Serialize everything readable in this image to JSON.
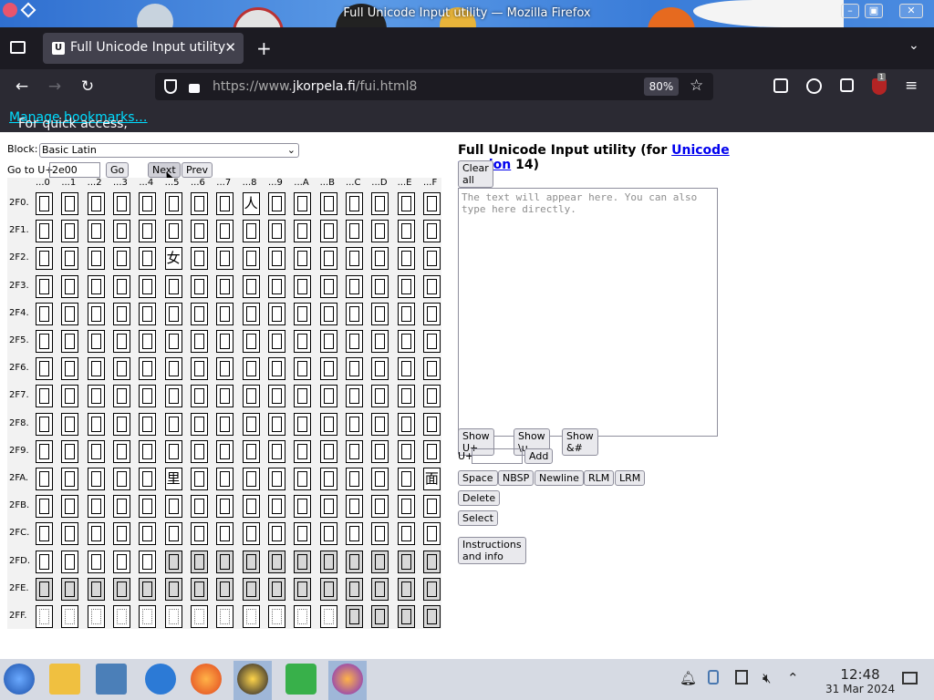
{
  "window": {
    "title": "Full Unicode Input utility — Mozilla Firefox"
  },
  "tab": {
    "label": "Full Unicode Input utility",
    "favicon": "U"
  },
  "nav": {
    "url_prefix": "https://www.",
    "url_domain": "jkorpela.fi",
    "url_path": "/fui.html8",
    "zoom": "80%",
    "addon_badge": "1"
  },
  "bookmarks": {
    "text": "For quick access, place your bookmarks here on the bookmarks toolbar.",
    "link": "Manage bookmarks…"
  },
  "left": {
    "block_label": "Block:",
    "block_value": "Basic Latin",
    "goto_label": "Go to U+",
    "goto_value": "2e00",
    "go_button": "Go",
    "next_button": "Next",
    "prev_button": "Prev",
    "col_headers": [
      "...0",
      "...1",
      "...2",
      "...3",
      "...4",
      "...5",
      "...6",
      "...7",
      "...8",
      "...9",
      "...A",
      "...B",
      "...C",
      "...D",
      "...E",
      "...F"
    ],
    "row_headers": [
      "2F0.",
      "2F1.",
      "2F2.",
      "2F3.",
      "2F4.",
      "2F5.",
      "2F6.",
      "2F7.",
      "2F8.",
      "2F9.",
      "2FA.",
      "2FB.",
      "2FC.",
      "2FD.",
      "2FE.",
      "2FF."
    ],
    "glyphs": [
      {
        "row": 0,
        "col": 8,
        "char": "人"
      },
      {
        "row": 2,
        "col": 5,
        "char": "女"
      },
      {
        "row": 10,
        "col": 5,
        "char": "里"
      },
      {
        "row": 10,
        "col": 15,
        "char": "面"
      }
    ]
  },
  "right": {
    "title_prefix": "Full Unicode Input utility (for ",
    "title_link": "Unicode version",
    "title_suffix": " 14)",
    "clear_all": "Clear all",
    "placeholder": "The text will appear here. You can also type here directly.",
    "show_u": "Show U+",
    "show_backslash_u": "Show \\u",
    "show_amp": "Show &#",
    "uplus_label": "U+",
    "add_button": "Add",
    "space_button": "Space",
    "nbsp_button": "NBSP",
    "newline_button": "Newline",
    "rlm_button": "RLM",
    "lrm_button": "LRM",
    "delete_button": "Delete",
    "select_button": "Select",
    "instructions_button": "Instructions and info"
  },
  "taskbar": {
    "time": "12:48",
    "date": "31 Mar 2024"
  }
}
